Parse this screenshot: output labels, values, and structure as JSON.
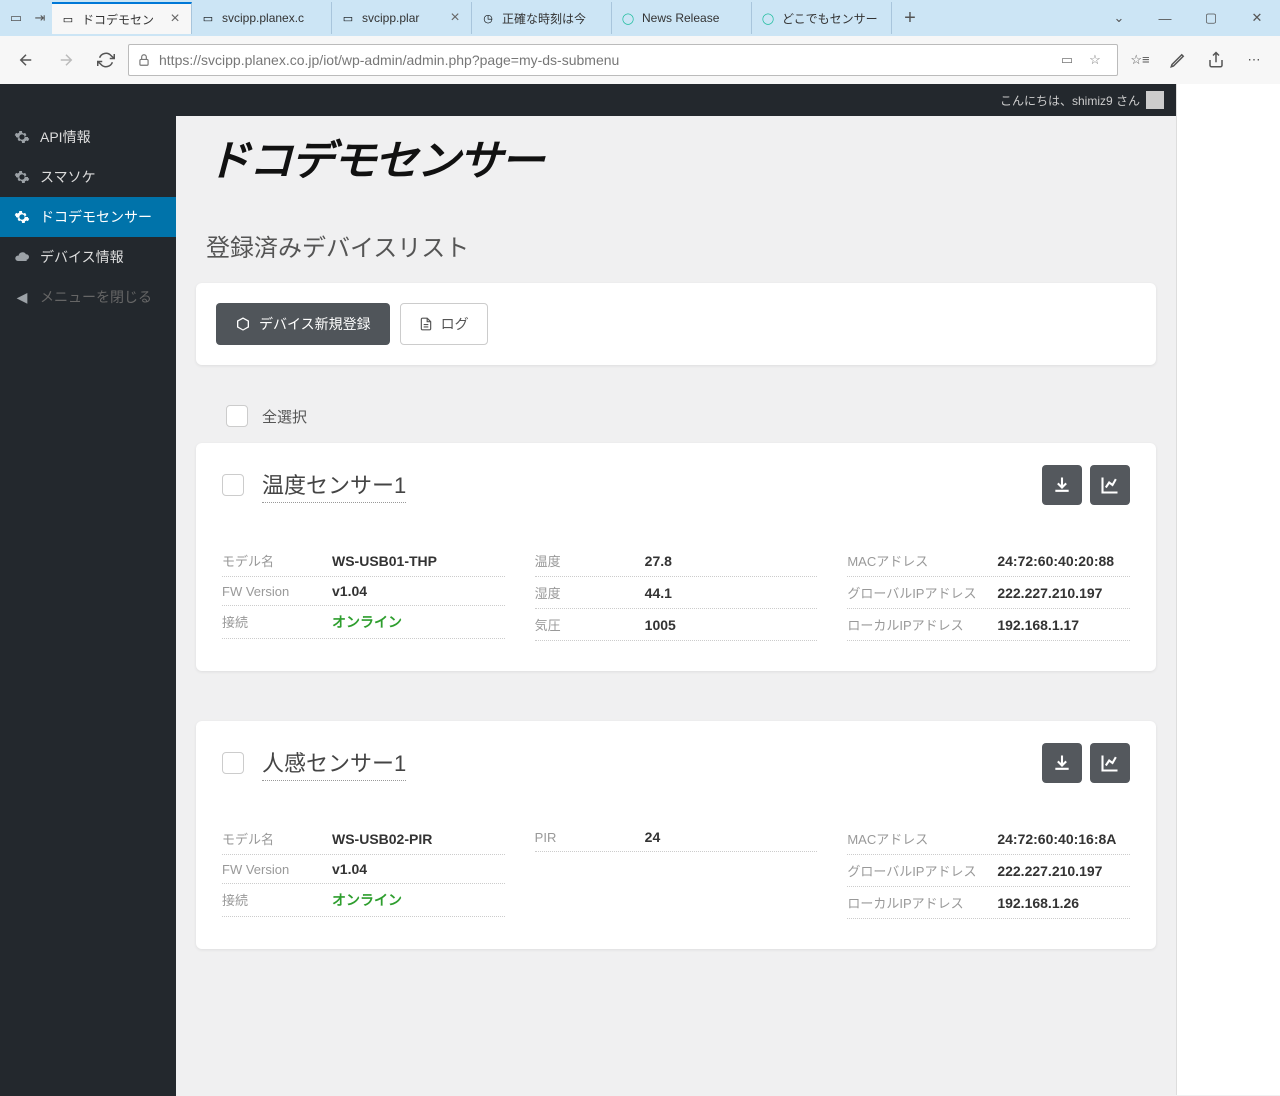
{
  "browser": {
    "tabs": [
      {
        "title": "ドコデモセン",
        "active": true
      },
      {
        "title": "svcipp.planex.c"
      },
      {
        "title": "svcipp.plar"
      },
      {
        "title": "正確な時刻は今"
      },
      {
        "title": "News Release"
      },
      {
        "title": "どこでもセンサー"
      }
    ],
    "url": "https://svcipp.planex.co.jp/iot/wp-admin/admin.php?page=my-ds-submenu"
  },
  "header": {
    "greeting": "こんにちは、shimiz9 さん"
  },
  "sidebar": {
    "items": [
      {
        "label": "API情報",
        "icon": "gear"
      },
      {
        "label": "スマソケ",
        "icon": "gear"
      },
      {
        "label": "ドコデモセンサー",
        "icon": "gear",
        "active": true
      },
      {
        "label": "デバイス情報",
        "icon": "cloud"
      }
    ],
    "collapse_label": "メニューを閉じる"
  },
  "main": {
    "logo_text": "ドコデモセンサー",
    "section_title": "登録済みデバイスリスト",
    "buttons": {
      "new_device": "デバイス新規登録",
      "log": "ログ"
    },
    "select_all_label": "全選択",
    "labels": {
      "model": "モデル名",
      "fw": "FW Version",
      "conn": "接続",
      "temp": "温度",
      "humid": "湿度",
      "press": "気圧",
      "pir": "PIR",
      "mac": "MACアドレス",
      "gip": "グローバルIPアドレス",
      "lip": "ローカルIPアドレス"
    },
    "devices": [
      {
        "name": "温度センサー1",
        "model": "WS-USB01-THP",
        "fw": "v1.04",
        "conn": "オンライン",
        "sensors": [
          {
            "key": "temp",
            "value": "27.8"
          },
          {
            "key": "humid",
            "value": "44.1"
          },
          {
            "key": "press",
            "value": "1005"
          }
        ],
        "mac": "24:72:60:40:20:88",
        "gip": "222.227.210.197",
        "lip": "192.168.1.17"
      },
      {
        "name": "人感センサー1",
        "model": "WS-USB02-PIR",
        "fw": "v1.04",
        "conn": "オンライン",
        "sensors": [
          {
            "key": "pir",
            "value": "24"
          }
        ],
        "mac": "24:72:60:40:16:8A",
        "gip": "222.227.210.197",
        "lip": "192.168.1.26"
      }
    ]
  }
}
